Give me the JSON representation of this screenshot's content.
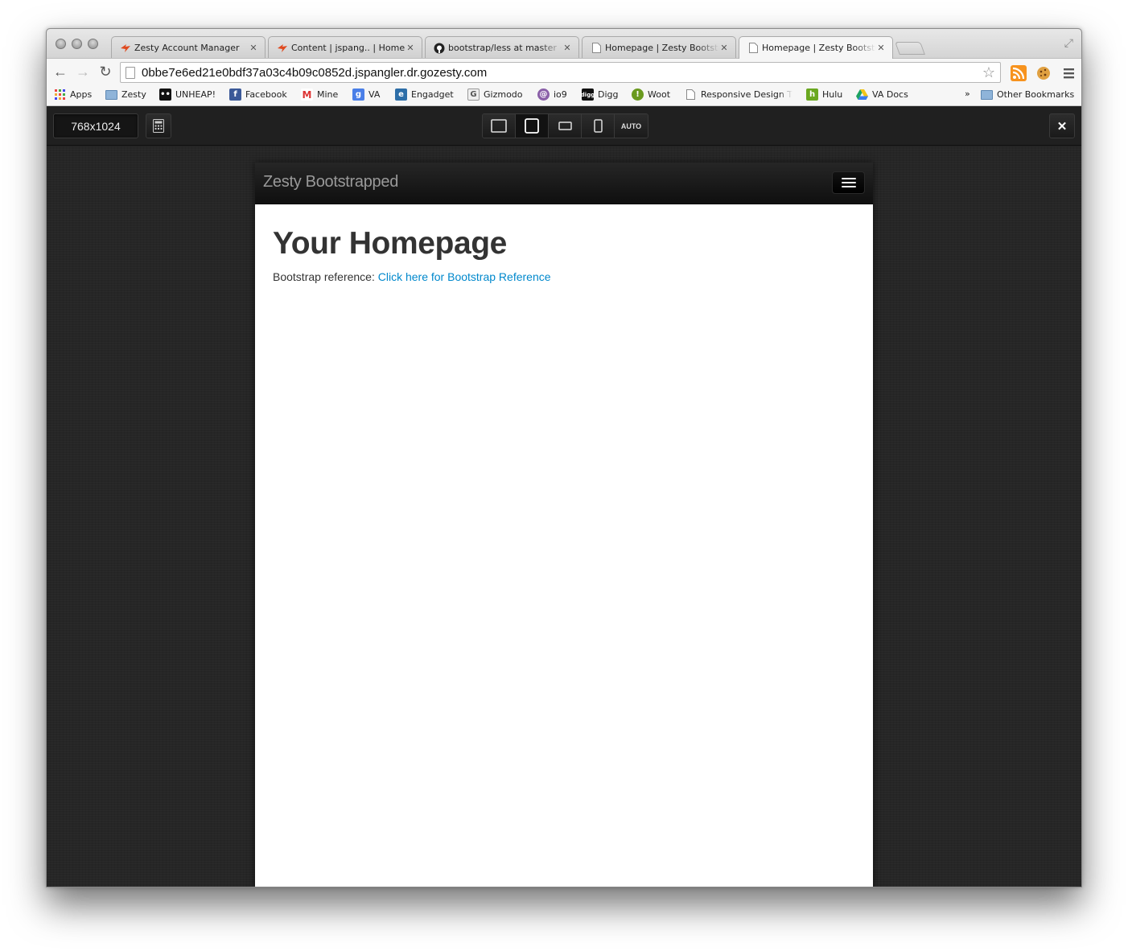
{
  "browser": {
    "tabs": [
      {
        "title": "Zesty Account Manager",
        "icon": "zesty-icon",
        "active": false
      },
      {
        "title": "Content | jspang.. | Home",
        "icon": "zesty-icon",
        "active": false
      },
      {
        "title": "bootstrap/less at master ·",
        "icon": "github-icon",
        "active": false
      },
      {
        "title": "Homepage | Zesty Bootstra",
        "icon": "page-icon",
        "active": false
      },
      {
        "title": "Homepage | Zesty Bootstra",
        "icon": "page-icon",
        "active": true
      }
    ],
    "url": "0bbe7e6ed21e0bdf37a03c4b09c0852d.jspangler.dr.gozesty.com",
    "bookmarks": [
      {
        "label": "Apps",
        "icon": "apps-grid-icon"
      },
      {
        "label": "Zesty",
        "icon": "folder-icon"
      },
      {
        "label": "UNHEAP!",
        "icon": "unheap-icon"
      },
      {
        "label": "Facebook",
        "icon": "facebook-icon"
      },
      {
        "label": "Mine",
        "icon": "gmail-icon"
      },
      {
        "label": "VA",
        "icon": "google-icon"
      },
      {
        "label": "Engadget",
        "icon": "engadget-icon"
      },
      {
        "label": "Gizmodo",
        "icon": "gizmodo-icon"
      },
      {
        "label": "io9",
        "icon": "io9-icon"
      },
      {
        "label": "Digg",
        "icon": "digg-icon"
      },
      {
        "label": "Woot",
        "icon": "woot-icon"
      },
      {
        "label": "Responsive Design T",
        "icon": "page-icon"
      },
      {
        "label": "Hulu",
        "icon": "hulu-icon"
      },
      {
        "label": "VA Docs",
        "icon": "drive-icon"
      }
    ],
    "bookmarks_overflow": "»",
    "other_bookmarks": "Other Bookmarks"
  },
  "tester": {
    "size_label": "768x1024",
    "auto_label": "AUTO",
    "close_glyph": "✕"
  },
  "site": {
    "brand": "Zesty Bootstrapped",
    "heading": "Your Homepage",
    "ref_label": "Bootstrap reference:",
    "ref_link": "Click here for Bootstrap Reference"
  },
  "colors": {
    "link": "#0088cc",
    "navbar": "#1b1b1b",
    "stage": "#262626"
  }
}
